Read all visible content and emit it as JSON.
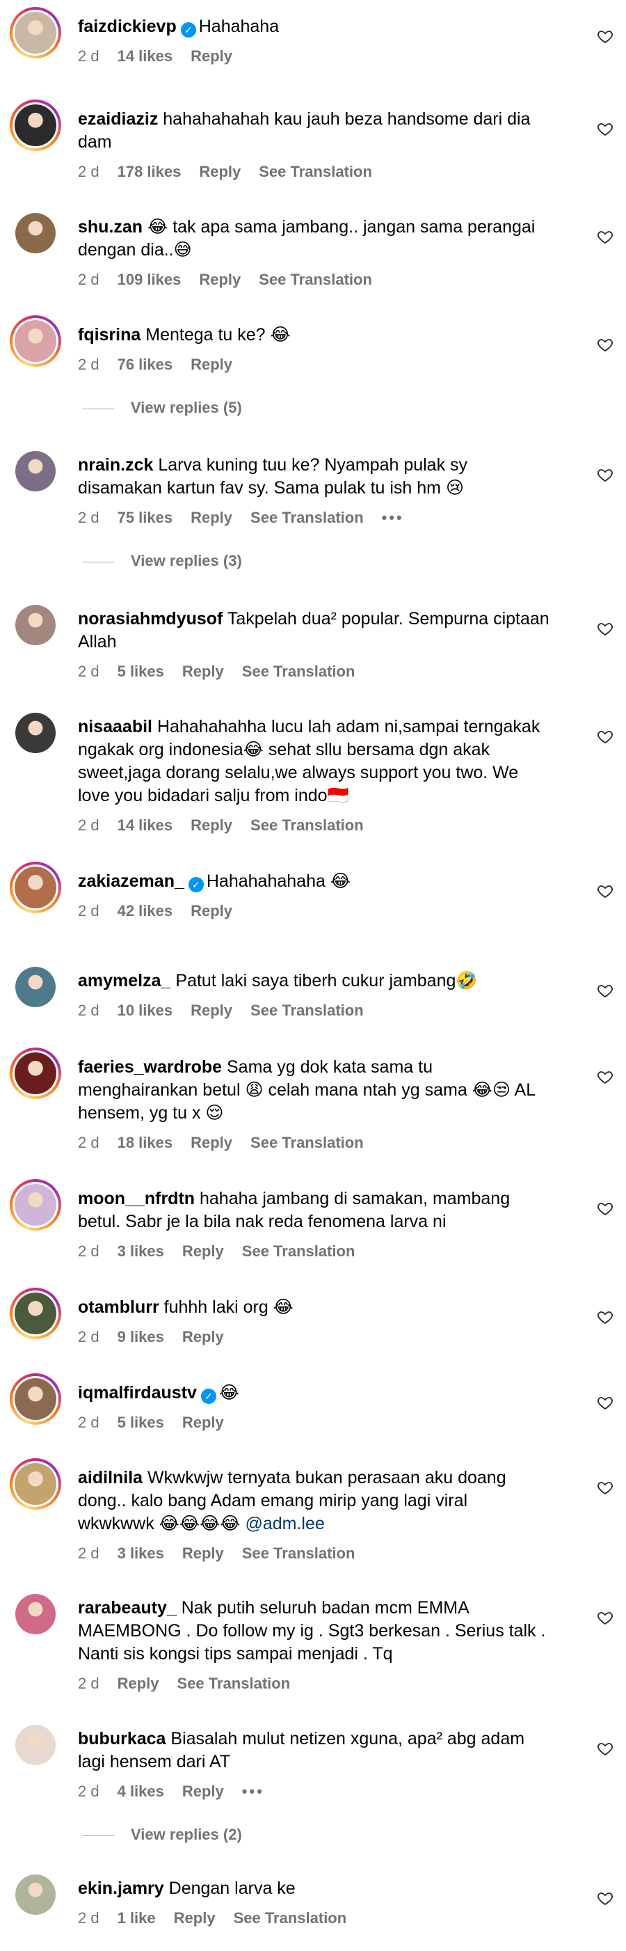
{
  "icons": {
    "heart": "heart-outline-icon",
    "verified": "verified-badge-icon",
    "more": "more-dots-icon"
  },
  "colors": {
    "secondary_text": "#737373",
    "verified_blue": "#0095f6",
    "mention": "#00376b"
  },
  "comments": [
    {
      "username": "faizdickievp",
      "verified": true,
      "text": "Hahahaha",
      "time": "2 d",
      "likes": "14 likes",
      "reply": "Reply",
      "translation": ""
    },
    {
      "username": "ezaidiaziz",
      "verified": false,
      "text": "hahahahahah kau jauh beza handsome dari dia\ndam",
      "time": "2 d",
      "likes": "178 likes",
      "reply": "Reply",
      "translation": "See Translation"
    },
    {
      "username": "shu.zan",
      "verified": false,
      "text": "😂 tak apa sama jambang.. jangan sama perangai\ndengan dia..😅",
      "time": "2 d",
      "likes": "109 likes",
      "reply": "Reply",
      "translation": "See Translation"
    },
    {
      "username": "fqisrina",
      "verified": false,
      "text": "Mentega tu ke? 😂",
      "time": "2 d",
      "likes": "76 likes",
      "reply": "Reply",
      "translation": "",
      "view_replies": "View replies (5)"
    },
    {
      "username": "nrain.zck",
      "verified": false,
      "text": "Larva kuning tuu ke? Nyampah pulak sy\ndisamakan kartun fav sy. Sama pulak tu ish hm 😢",
      "time": "2 d",
      "likes": "75 likes",
      "reply": "Reply",
      "translation": "See Translation",
      "more": "•••",
      "view_replies": "View replies (3)"
    },
    {
      "username": "norasiahmdyusof",
      "verified": false,
      "text": "Takpelah dua² popular. Sempurna ciptaan\nAllah",
      "time": "2 d",
      "likes": "5 likes",
      "reply": "Reply",
      "translation": "See Translation"
    },
    {
      "username": "nisaaabil",
      "verified": false,
      "text": "Hahahahahha lucu lah adam ni,sampai terngakak\nngakak org indonesia😂 sehat sllu bersama dgn akak\nsweet,jaga dorang selalu,we always support you two. We\nlove you bidadari salju from indo🇮🇩",
      "time": "2 d",
      "likes": "14 likes",
      "reply": "Reply",
      "translation": "See Translation"
    },
    {
      "username": "zakiazeman_",
      "verified": true,
      "text": "Hahahahahaha 😂",
      "time": "2 d",
      "likes": "42 likes",
      "reply": "Reply",
      "translation": ""
    },
    {
      "username": "amymelza_",
      "verified": false,
      "text": "Patut laki saya tiberh cukur jambang🤣",
      "time": "2 d",
      "likes": "10 likes",
      "reply": "Reply",
      "translation": "See Translation"
    },
    {
      "username": "faeries_wardrobe",
      "verified": false,
      "text": "Sama yg dok kata sama tu\nmenghairankan betul 😩 celah mana ntah yg sama 😂😒 AL\nhensem, yg tu x 😌",
      "time": "2 d",
      "likes": "18 likes",
      "reply": "Reply",
      "translation": "See Translation"
    },
    {
      "username": "moon__nfrdtn",
      "verified": false,
      "text": "hahaha jambang di samakan, mambang\nbetul. Sabr je la bila nak reda fenomena larva ni",
      "time": "2 d",
      "likes": "3 likes",
      "reply": "Reply",
      "translation": "See Translation"
    },
    {
      "username": "otamblurr",
      "verified": false,
      "text": "fuhhh laki org 😂",
      "time": "2 d",
      "likes": "9 likes",
      "reply": "Reply",
      "translation": ""
    },
    {
      "username": "iqmalfirdaustv",
      "verified": true,
      "text": "😂",
      "time": "2 d",
      "likes": "5 likes",
      "reply": "Reply",
      "translation": ""
    },
    {
      "username": "aidilnila",
      "verified": false,
      "text": "Wkwkwjw ternyata bukan perasaan aku doang\ndong.. kalo bang Adam emang mirip yang lagi viral\nwkwkwwk 😂😂😂😂",
      "mention": "@adm.lee",
      "time": "2 d",
      "likes": "3 likes",
      "reply": "Reply",
      "translation": "See Translation"
    },
    {
      "username": "rarabeauty_",
      "verified": false,
      "text": "Nak putih seluruh badan mcm EMMA\nMAEMBONG . Do follow my ig . Sgt3 berkesan . Serius talk .\nNanti sis kongsi tips sampai menjadi . Tq",
      "time": "2 d",
      "likes": "",
      "reply": "Reply",
      "translation": "See Translation"
    },
    {
      "username": "buburkaca",
      "verified": false,
      "text": "Biasalah mulut netizen xguna, apa² abg adam\nlagi hensem dari AT",
      "time": "2 d",
      "likes": "4 likes",
      "reply": "Reply",
      "translation": "",
      "more": "•••",
      "view_replies": "View replies (2)"
    },
    {
      "username": "ekin.jamry",
      "verified": false,
      "text": "Dengan larva ke",
      "time": "2 d",
      "likes": "1 like",
      "reply": "Reply",
      "translation": "See Translation"
    }
  ]
}
